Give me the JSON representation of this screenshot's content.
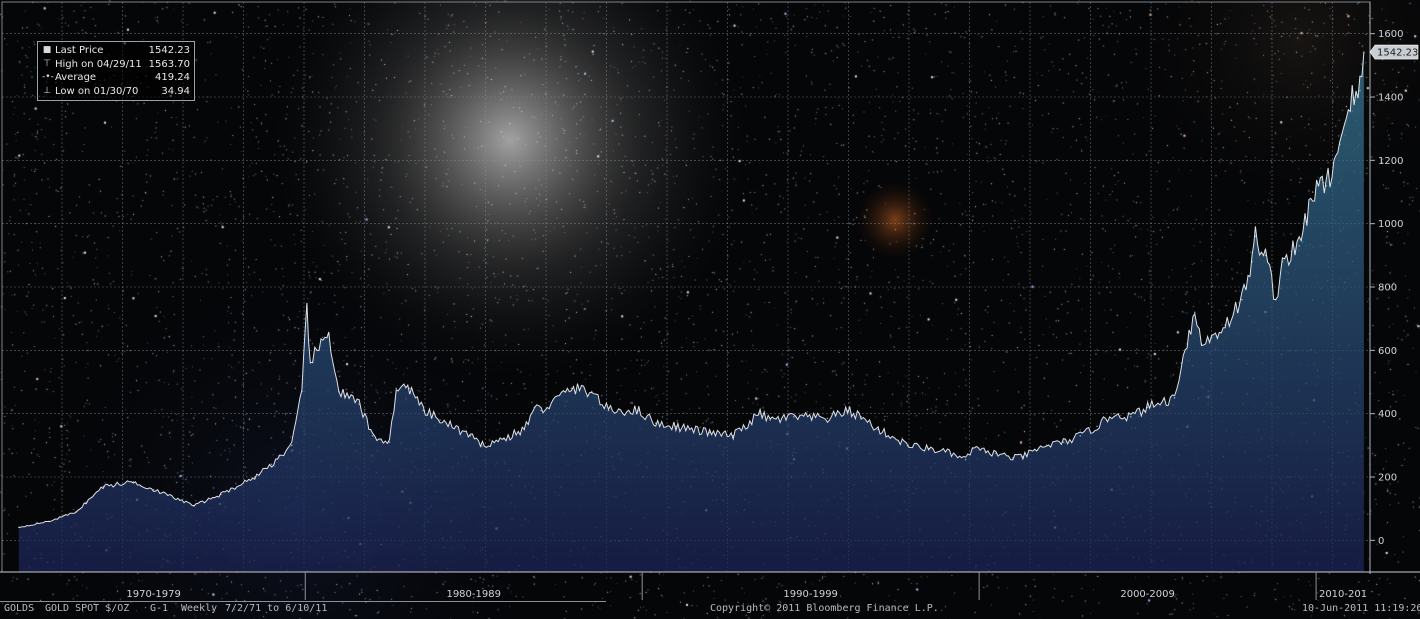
{
  "legend": {
    "last_price_label": "Last Price",
    "last_price_value": "1542.23",
    "high_label": "High on 04/29/11",
    "high_value": "1563.70",
    "average_label": "Average",
    "average_value": "419.24",
    "low_label": "Low on 01/30/70",
    "low_value": "34.94"
  },
  "last_value_tag": "1542.23",
  "footer": {
    "ticker": "GOLDS",
    "security": "GOLD SPOT $/OZ",
    "chart_id": "G-1",
    "frequency": "Weekly",
    "range": "7/2/71 to 6/10/11",
    "copyright": "Copyright© 2011 Bloomberg Finance L.P.",
    "timestamp": "10-Jun-2011 11:19:26"
  },
  "colors": {
    "line": "#e8ecef",
    "area_top": "#3b7f9c",
    "area_bottom": "#1c2456",
    "grid": "#8a9199",
    "tag_bg": "#c9ced2"
  },
  "chart_data": {
    "type": "area",
    "title": "",
    "xlabel": "",
    "ylabel": "",
    "x_range": [
      "1971-07",
      "2011-06"
    ],
    "ylim": [
      -100,
      1700
    ],
    "y_ticks": [
      0,
      200,
      400,
      600,
      800,
      1000,
      1200,
      1400,
      1600
    ],
    "x_period_labels": [
      "1970-1979",
      "1980-1989",
      "1990-1999",
      "2000-2009",
      "2010-201"
    ],
    "grid": true,
    "legend_position": "top-left",
    "series": [
      {
        "name": "GOLD SPOT $/OZ",
        "x": [
          1971.5,
          1972.4,
          1973.2,
          1973.5,
          1974.0,
          1974.9,
          1975.5,
          1976.7,
          1977.5,
          1978.5,
          1979.0,
          1979.6,
          1979.9,
          1980.05,
          1980.15,
          1980.35,
          1980.7,
          1981.0,
          1981.6,
          1982.0,
          1982.5,
          1982.7,
          1983.1,
          1983.5,
          1984.0,
          1984.9,
          1985.2,
          1985.9,
          1986.5,
          1986.8,
          1987.0,
          1987.9,
          1988.5,
          1989.0,
          1989.9,
          1990.4,
          1991.0,
          1992.0,
          1992.7,
          1993.5,
          1993.8,
          1994.5,
          1995.5,
          1996.1,
          1996.5,
          1997.0,
          1997.9,
          1998.5,
          1999.0,
          1999.6,
          1999.8,
          2000.2,
          2000.5,
          2001.0,
          2001.3,
          2002.0,
          2002.5,
          2003.0,
          2003.5,
          2004.0,
          2004.5,
          2005.0,
          2005.8,
          2006.0,
          2006.4,
          2006.6,
          2006.9,
          2007.3,
          2007.8,
          2008.1,
          2008.2,
          2008.5,
          2008.8,
          2009.0,
          2009.5,
          2009.9,
          2010.3,
          2010.7,
          2010.9,
          2011.3,
          2011.42
        ],
        "values": [
          41,
          60,
          90,
          120,
          170,
          185,
          160,
          110,
          145,
          200,
          240,
          300,
          470,
          740,
          560,
          600,
          650,
          470,
          430,
          330,
          310,
          480,
          480,
          410,
          380,
          330,
          300,
          320,
          350,
          420,
          410,
          480,
          470,
          410,
          410,
          370,
          360,
          340,
          330,
          400,
          380,
          390,
          385,
          410,
          390,
          350,
          300,
          290,
          280,
          255,
          290,
          280,
          275,
          260,
          265,
          300,
          310,
          330,
          360,
          400,
          390,
          420,
          450,
          560,
          720,
          620,
          640,
          680,
          760,
          880,
          960,
          900,
          760,
          880,
          930,
          1100,
          1120,
          1250,
          1370,
          1420,
          1542
        ]
      }
    ]
  }
}
